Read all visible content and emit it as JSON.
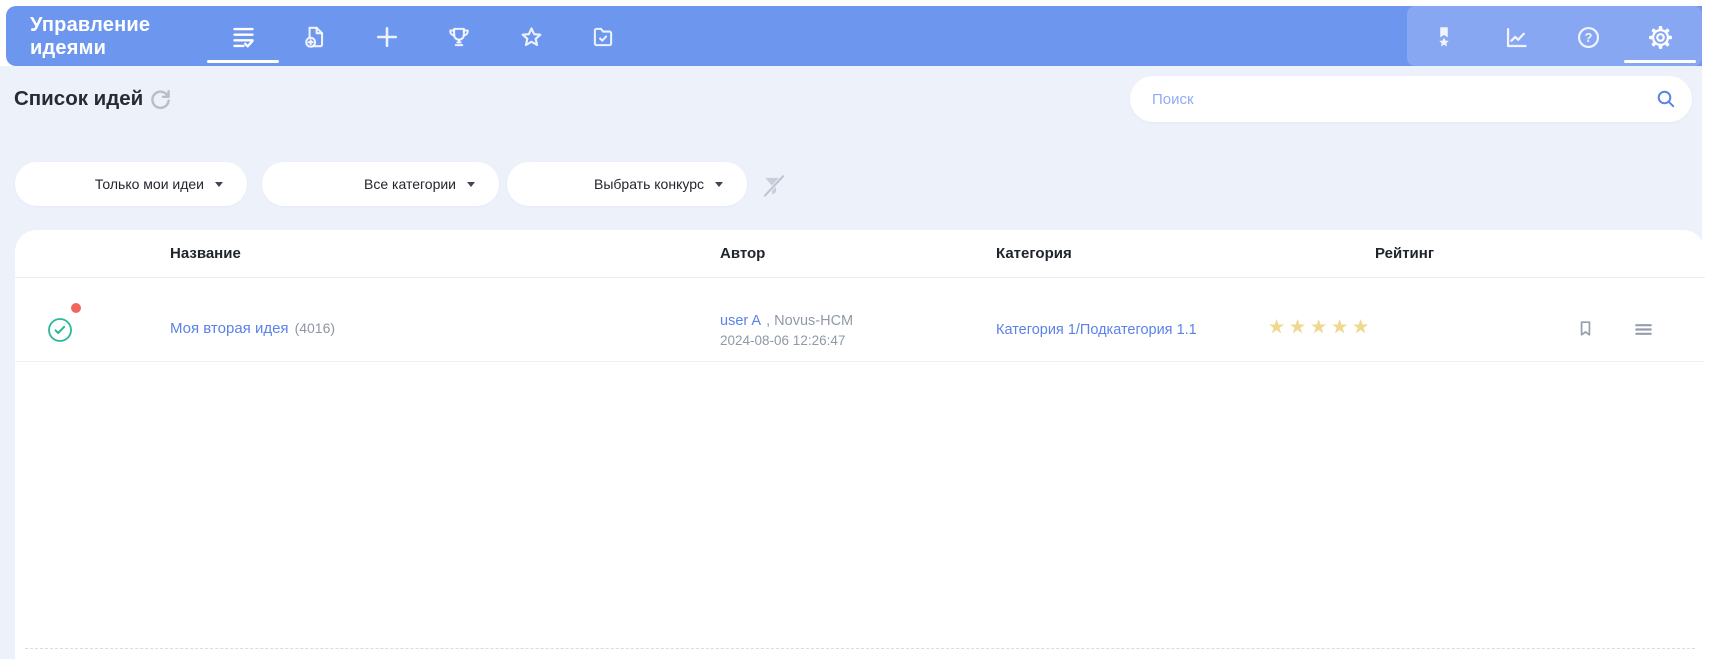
{
  "app": {
    "title": "Управление идеями"
  },
  "header": {
    "nav_icons": [
      "list-check-icon",
      "document-plus-icon",
      "plus-icon",
      "trophy-icon",
      "star-icon",
      "folder-check-icon"
    ],
    "active_nav_icon": "list-check-icon",
    "right_icons": [
      "medal-icon",
      "chart-icon",
      "help-icon",
      "settings-gear-icon"
    ],
    "active_right_icon": "settings-gear-icon"
  },
  "page": {
    "title": "Список идей"
  },
  "search": {
    "placeholder": "Поиск",
    "value": ""
  },
  "filters": {
    "only_my_ideas": "Только мои идеи",
    "all_categories": "Все категории",
    "select_contest": "Выбрать конкурс"
  },
  "table": {
    "columns": [
      "Название",
      "Автор",
      "Категория",
      "Рейтинг"
    ],
    "rows": [
      {
        "status": "approved",
        "has_notification": true,
        "title": "Моя вторая идея",
        "code": "(4016)",
        "author": "user A",
        "author_suffix": ", Novus-HCM",
        "created": "2024-08-06 12:26:47",
        "category": "Категория 1/Подкатегория 1.1",
        "rating": 5,
        "stars": "★★★★★"
      }
    ]
  },
  "colors": {
    "header_blue": "#6d96ef",
    "header_panel_blue": "#88a7f2",
    "page_bg": "#edf1fa",
    "link_blue": "#5b82ea",
    "star_gold": "#f0d88e",
    "status_teal": "#28b79b",
    "alert_red": "#f2655c"
  }
}
